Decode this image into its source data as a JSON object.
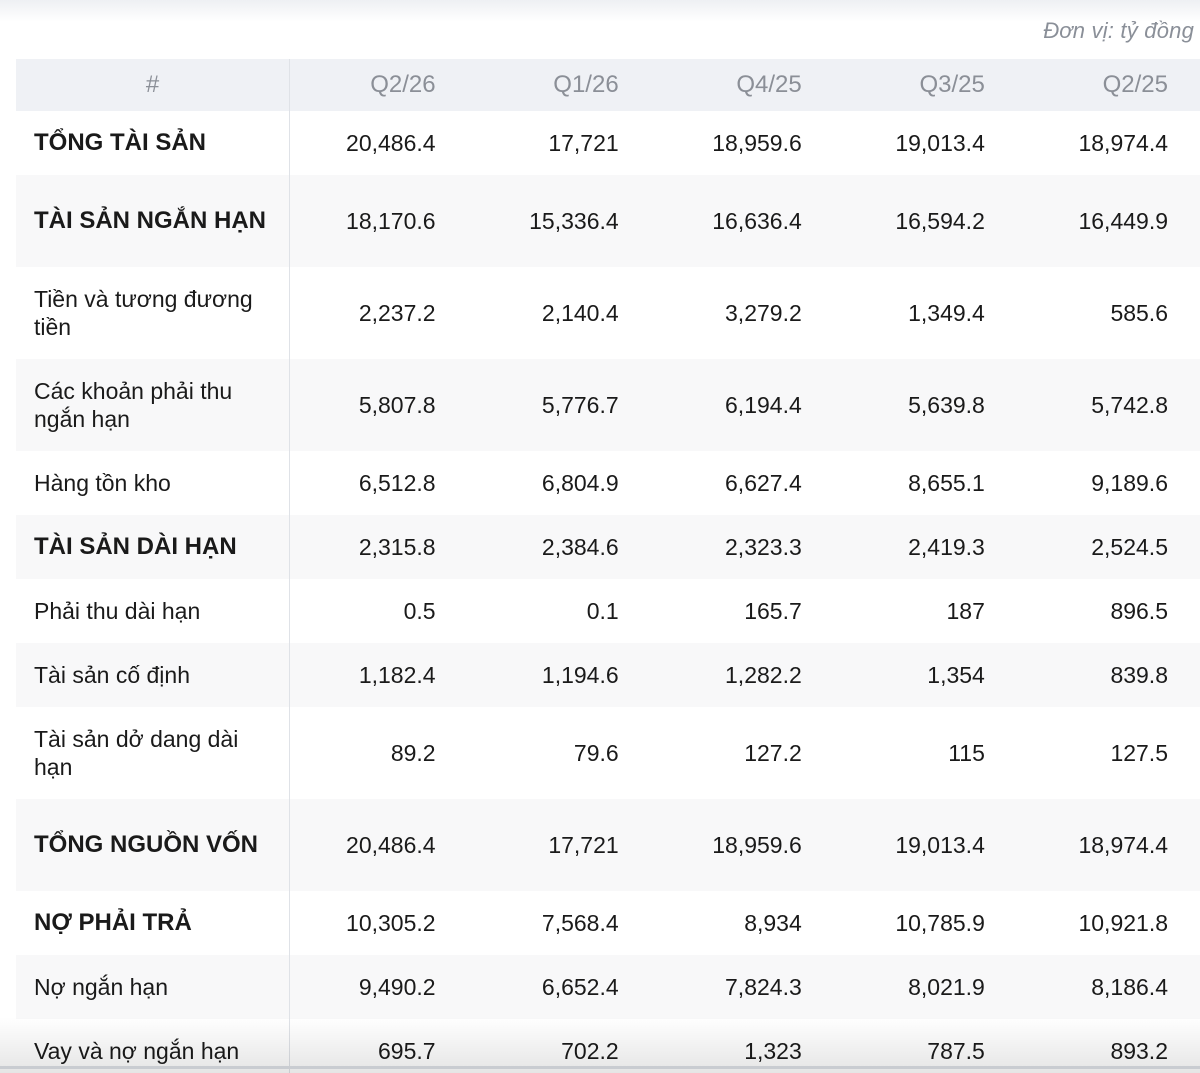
{
  "unit_note": "Đơn vị: tỷ đồng",
  "header": {
    "label": "#",
    "periods": [
      "Q2/26",
      "Q1/26",
      "Q4/25",
      "Q3/25",
      "Q2/25"
    ]
  },
  "rows": [
    {
      "label": "TỔNG TÀI SẢN",
      "bold": true,
      "values": [
        "20,486.4",
        "17,721",
        "18,959.6",
        "19,013.4",
        "18,974.4"
      ]
    },
    {
      "label": "TÀI SẢN NGẮN HẠN",
      "bold": true,
      "values": [
        "18,170.6",
        "15,336.4",
        "16,636.4",
        "16,594.2",
        "16,449.9"
      ]
    },
    {
      "label": "Tiền và tương đương tiền",
      "bold": false,
      "values": [
        "2,237.2",
        "2,140.4",
        "3,279.2",
        "1,349.4",
        "585.6"
      ]
    },
    {
      "label": "Các khoản phải thu ngắn hạn",
      "bold": false,
      "values": [
        "5,807.8",
        "5,776.7",
        "6,194.4",
        "5,639.8",
        "5,742.8"
      ]
    },
    {
      "label": "Hàng tồn kho",
      "bold": false,
      "values": [
        "6,512.8",
        "6,804.9",
        "6,627.4",
        "8,655.1",
        "9,189.6"
      ]
    },
    {
      "label": "TÀI SẢN DÀI HẠN",
      "bold": true,
      "values": [
        "2,315.8",
        "2,384.6",
        "2,323.3",
        "2,419.3",
        "2,524.5"
      ]
    },
    {
      "label": "Phải thu dài hạn",
      "bold": false,
      "values": [
        "0.5",
        "0.1",
        "165.7",
        "187",
        "896.5"
      ]
    },
    {
      "label": "Tài sản cố định",
      "bold": false,
      "values": [
        "1,182.4",
        "1,194.6",
        "1,282.2",
        "1,354",
        "839.8"
      ]
    },
    {
      "label": "Tài sản dở dang dài hạn",
      "bold": false,
      "values": [
        "89.2",
        "79.6",
        "127.2",
        "115",
        "127.5"
      ]
    },
    {
      "label": "TỔNG NGUỒN VỐN",
      "bold": true,
      "values": [
        "20,486.4",
        "17,721",
        "18,959.6",
        "19,013.4",
        "18,974.4"
      ]
    },
    {
      "label": "NỢ PHẢI TRẢ",
      "bold": true,
      "values": [
        "10,305.2",
        "7,568.4",
        "8,934",
        "10,785.9",
        "10,921.8"
      ]
    },
    {
      "label": "Nợ ngắn hạn",
      "bold": false,
      "values": [
        "9,490.2",
        "6,652.4",
        "7,824.3",
        "8,021.9",
        "8,186.4"
      ]
    },
    {
      "label": "Vay và nợ ngắn hạn",
      "bold": false,
      "values": [
        "695.7",
        "702.2",
        "1,323",
        "787.5",
        "893.2"
      ]
    }
  ]
}
